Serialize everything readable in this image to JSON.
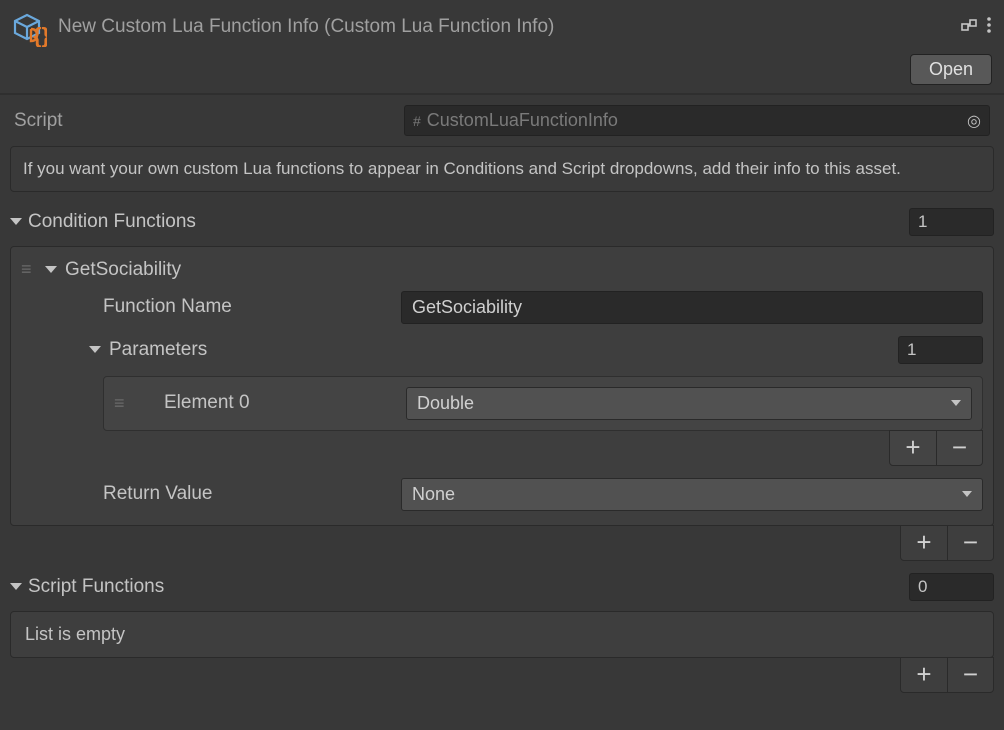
{
  "header": {
    "title": "New Custom Lua Function Info (Custom Lua Function Info)",
    "open_label": "Open"
  },
  "script": {
    "label": "Script",
    "value": "CustomLuaFunctionInfo"
  },
  "info_text": "If you want your own custom Lua functions to appear in Conditions and Script dropdowns, add their info to this asset.",
  "condition_functions": {
    "label": "Condition Functions",
    "size": "1",
    "items": [
      {
        "name": "GetSociability",
        "function_name_label": "Function Name",
        "function_name": "GetSociability",
        "parameters_label": "Parameters",
        "parameters_size": "1",
        "parameters": [
          {
            "label": "Element 0",
            "type": "Double"
          }
        ],
        "return_label": "Return Value",
        "return_value": "None"
      }
    ]
  },
  "script_functions": {
    "label": "Script Functions",
    "size": "0",
    "empty_text": "List is empty"
  }
}
